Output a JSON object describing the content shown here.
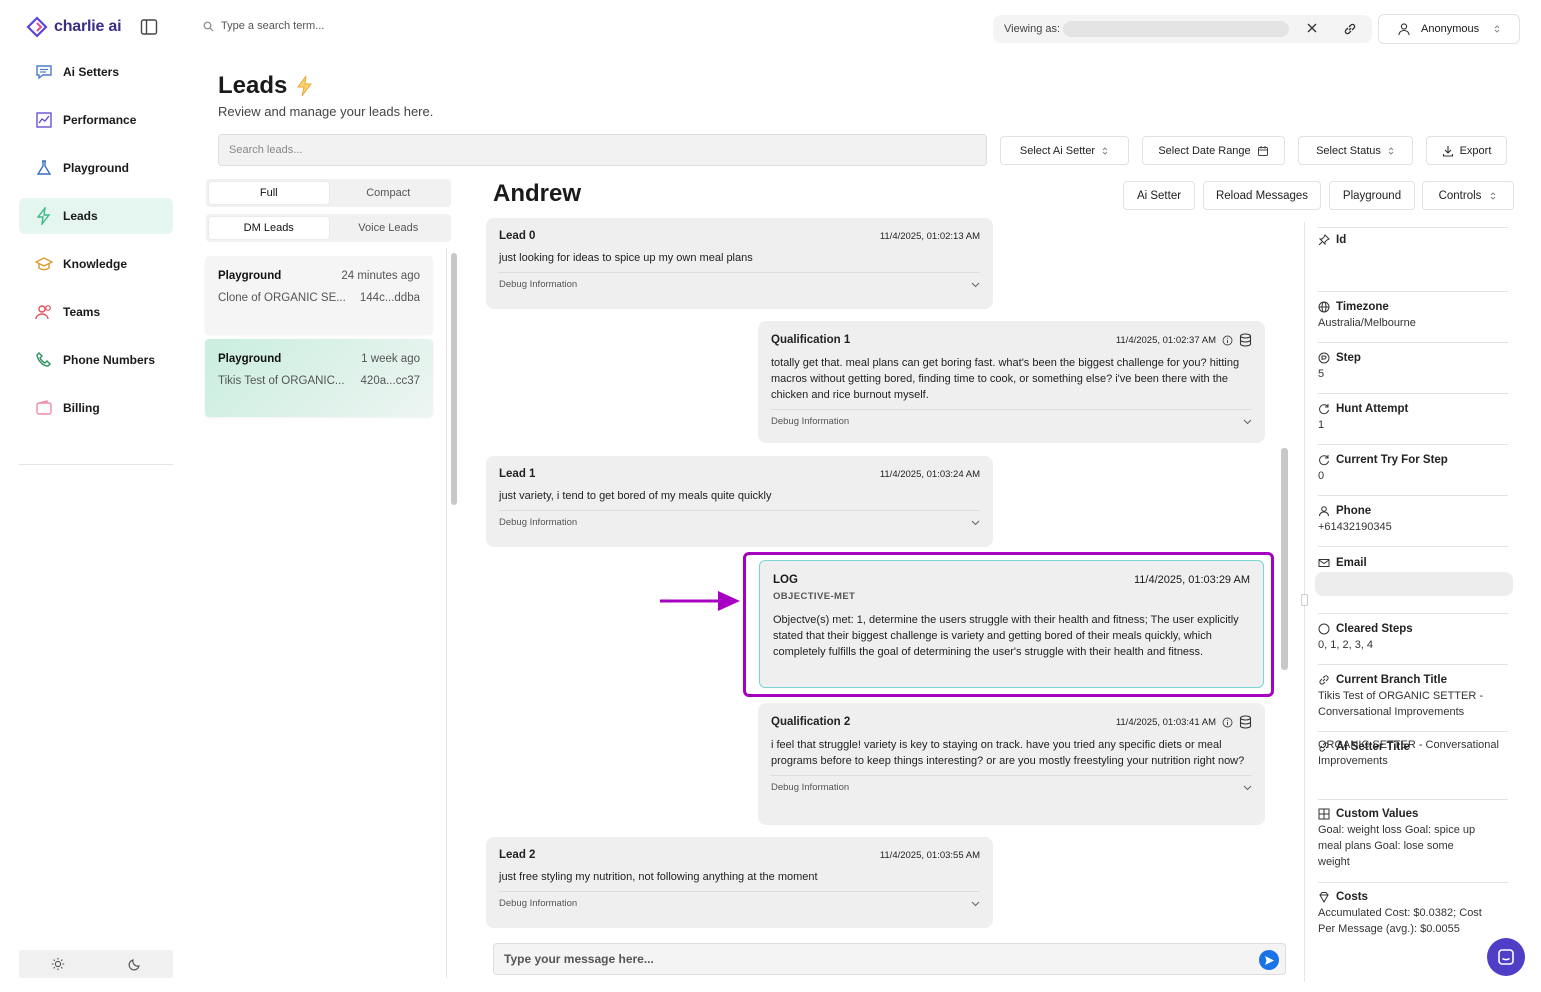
{
  "app": {
    "logo_text": "charlie ai",
    "brand_color": "#3a2f86"
  },
  "sidebar": {
    "items": [
      {
        "label": "Ai Setters",
        "icon": "chat-icon",
        "active": false
      },
      {
        "label": "Performance",
        "icon": "chart-icon",
        "active": false
      },
      {
        "label": "Playground",
        "icon": "flask-icon",
        "active": false
      },
      {
        "label": "Leads",
        "icon": "bolt-icon",
        "active": true
      },
      {
        "label": "Knowledge",
        "icon": "graduation-cap-icon",
        "active": false
      },
      {
        "label": "Teams",
        "icon": "users-icon",
        "active": false
      },
      {
        "label": "Phone Numbers",
        "icon": "phone-icon",
        "active": false
      },
      {
        "label": "Billing",
        "icon": "wallet-icon",
        "active": false
      }
    ]
  },
  "topbar": {
    "search_placeholder": "Type a search term...",
    "viewing_label": "Viewing as:",
    "user_label": "Anonymous"
  },
  "page": {
    "title": "Leads",
    "subtitle": "Review and manage your leads here.",
    "search_placeholder": "Search leads...",
    "filters": {
      "ai_setter": "Select Ai Setter",
      "date_range": "Select Date Range",
      "status": "Select Status",
      "export": "Export"
    }
  },
  "lead_list": {
    "view_tabs": [
      "Full",
      "Compact"
    ],
    "type_tabs": [
      "DM Leads",
      "Voice Leads"
    ],
    "leads": [
      {
        "name": "Playground",
        "time": "24 minutes ago",
        "setter": "Clone of ORGANIC SE...",
        "id": "144c...ddba"
      },
      {
        "name": "Playground",
        "time": "1 week ago",
        "setter": "Tikis Test of ORGANIC...",
        "id": "420a...cc37"
      }
    ]
  },
  "conversation": {
    "lead_name": "Andrew",
    "buttons": {
      "ai_setter": "Ai Setter",
      "reload": "Reload Messages",
      "playground": "Playground",
      "controls": "Controls"
    },
    "debug_label": "Debug Information",
    "messages": [
      {
        "sender": "Lead 0",
        "time": "11/4/2025, 01:02:13 AM",
        "text": "just looking for ideas to spice up my own meal plans"
      },
      {
        "sender": "Qualification 1",
        "time": "11/4/2025, 01:02:37 AM",
        "text": "totally get that. meal plans can get boring fast. what's been the biggest challenge for you? hitting macros without getting bored, finding time to cook, or something else? i've been there with the chicken and rice burnout myself."
      },
      {
        "sender": "Lead 1",
        "time": "11/4/2025, 01:03:24 AM",
        "text": "just variety, i tend to get bored of my meals quite quickly"
      },
      {
        "sender": "Qualification 2",
        "time": "11/4/2025, 01:03:41 AM",
        "text": "i feel that struggle! variety is key to staying on track. have you tried any specific diets or meal programs before to keep things interesting? or are you mostly freestyling your nutrition right now?"
      },
      {
        "sender": "Lead 2",
        "time": "11/4/2025, 01:03:55 AM",
        "text": "just free styling my nutrition, not following anything at the moment"
      }
    ],
    "log": {
      "label": "LOG",
      "time": "11/4/2025, 01:03:29 AM",
      "tag": "OBJECTIVE-MET",
      "text": "Objectve(s) met: 1, determine the users struggle with their health and fitness; The user explicitly stated that their biggest challenge is variety and getting bored of their meals quickly, which completely fulfills the goal of determining the user's struggle with their health and fitness."
    },
    "input_placeholder": "Type your message here..."
  },
  "details": {
    "id": {
      "label": "Id",
      "value": ""
    },
    "timezone": {
      "label": "Timezone",
      "value": "Australia/Melbourne"
    },
    "step": {
      "label": "Step",
      "value": "5"
    },
    "hunt_attempt": {
      "label": "Hunt Attempt",
      "value": "1"
    },
    "current_try": {
      "label": "Current Try For Step",
      "value": "0"
    },
    "phone": {
      "label": "Phone",
      "value": "+61432190345"
    },
    "email": {
      "label": "Email",
      "value": ""
    },
    "cleared_steps": {
      "label": "Cleared Steps",
      "value": "0, 1, 2, 3, 4"
    },
    "branch_title": {
      "label": "Current Branch Title",
      "value": "Tikis Test of ORGANIC SETTER - Conversational Improvements"
    },
    "setter_title": {
      "label": "AI Setter Title",
      "value": "ORGANIC SETTER - Conversational Improvements"
    },
    "custom_values": {
      "label": "Custom Values",
      "value": "Goal: weight loss Goal: spice up meal plans Goal: lose some weight"
    },
    "costs": {
      "label": "Costs",
      "value": "Accumulated Cost: $0.0382; Cost Per Message (avg.): $0.0055"
    }
  },
  "colors": {
    "highlight": "#a800c2",
    "active_nav": "#e4f6ef",
    "send_button": "#1a74e8"
  }
}
